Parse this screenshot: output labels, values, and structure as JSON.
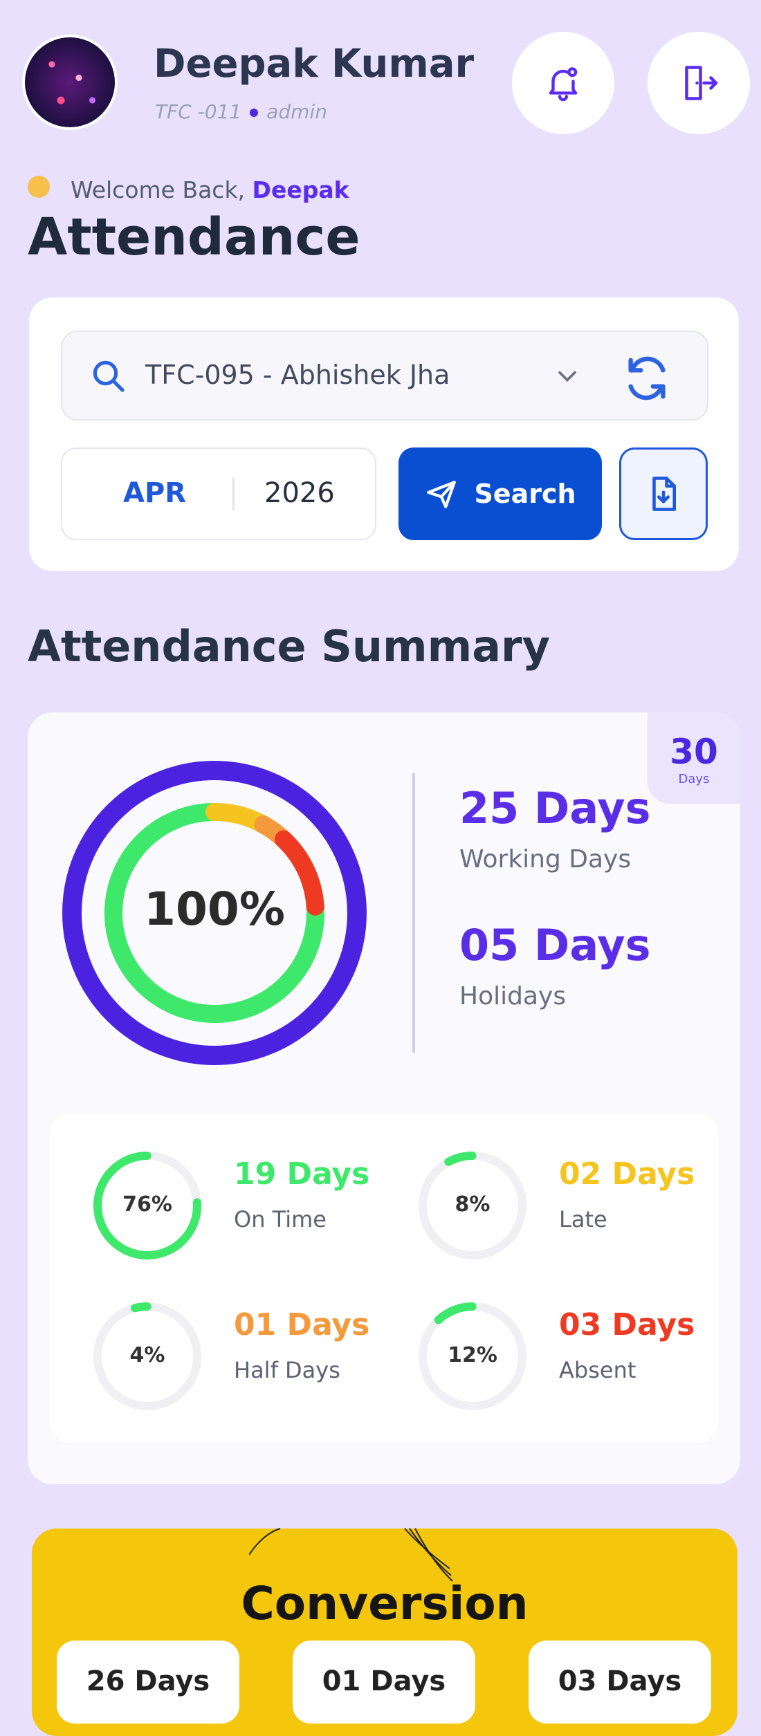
{
  "header": {
    "name": "Deepak Kumar",
    "emp_id": "TFC -011",
    "role": "admin",
    "welcome_prefix": "Welcome Back,",
    "welcome_name": "Deepak",
    "page_title": "Attendance"
  },
  "filters": {
    "employee": "TFC-095 - Abhishek Jha",
    "month": "APR",
    "year": "2026",
    "search_label": "Search"
  },
  "summary": {
    "title": "Attendance Summary",
    "total_days": "30",
    "total_days_label": "Days",
    "percent": "100%",
    "working_days": "25 Days",
    "working_days_label": "Working Days",
    "holidays": "05 Days",
    "holidays_label": "Holidays",
    "stats": [
      {
        "pct": "76%",
        "value": "19 Days",
        "label": "On Time",
        "fraction": 0.76,
        "color": "#3de86a"
      },
      {
        "pct": "8%",
        "value": "02 Days",
        "label": "Late",
        "fraction": 0.08,
        "color": "#f6c41e"
      },
      {
        "pct": "4%",
        "value": "01 Days",
        "label": "Half Days",
        "fraction": 0.04,
        "color": "#f49a3c"
      },
      {
        "pct": "12%",
        "value": "03 Days",
        "label": "Absent",
        "fraction": 0.12,
        "color": "#ee3a22"
      }
    ],
    "ring": {
      "outer_color": "#4b22e0",
      "on_time_color": "#3de86a",
      "late_color": "#f6c41e",
      "half_color": "#f49a3c",
      "absent_color": "#ee3a22"
    }
  },
  "conversion": {
    "title": "Conversion",
    "boxes": [
      "26 Days",
      "01 Days",
      "03 Days"
    ]
  }
}
